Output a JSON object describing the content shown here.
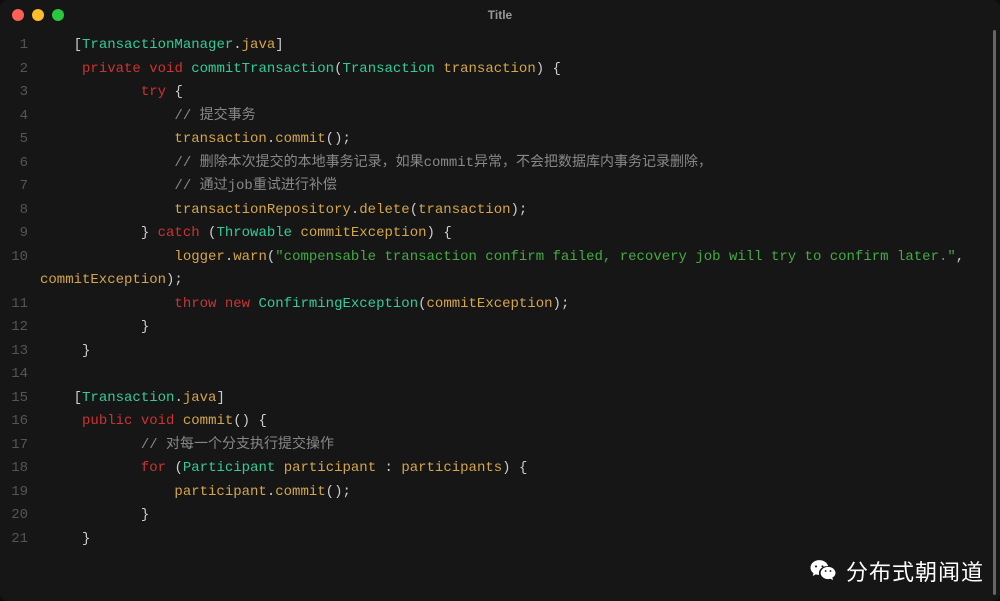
{
  "title": "Title",
  "watermark": "分布式朝闻道",
  "lines": [
    {
      "n": 1,
      "tokens": [
        {
          "t": "    [",
          "c": "c-pun"
        },
        {
          "t": "TransactionManager",
          "c": "c-type"
        },
        {
          "t": ".",
          "c": "c-pun"
        },
        {
          "t": "java",
          "c": "c-var"
        },
        {
          "t": "]",
          "c": "c-pun"
        }
      ]
    },
    {
      "n": 2,
      "tokens": [
        {
          "t": "     ",
          "c": "c-pun"
        },
        {
          "t": "private",
          "c": "c-kw"
        },
        {
          "t": " ",
          "c": "c-pun"
        },
        {
          "t": "void",
          "c": "c-kw"
        },
        {
          "t": " ",
          "c": "c-pun"
        },
        {
          "t": "commitTransaction",
          "c": "c-type"
        },
        {
          "t": "(",
          "c": "c-pun"
        },
        {
          "t": "Transaction",
          "c": "c-type"
        },
        {
          "t": " ",
          "c": "c-pun"
        },
        {
          "t": "transaction",
          "c": "c-var"
        },
        {
          "t": ") {",
          "c": "c-pun"
        }
      ]
    },
    {
      "n": 3,
      "tokens": [
        {
          "t": "            ",
          "c": "c-pun"
        },
        {
          "t": "try",
          "c": "c-kw"
        },
        {
          "t": " {",
          "c": "c-pun"
        }
      ]
    },
    {
      "n": 4,
      "tokens": [
        {
          "t": "                ",
          "c": "c-pun"
        },
        {
          "t": "// 提交事务",
          "c": "c-com"
        }
      ]
    },
    {
      "n": 5,
      "tokens": [
        {
          "t": "                ",
          "c": "c-pun"
        },
        {
          "t": "transaction",
          "c": "c-var"
        },
        {
          "t": ".",
          "c": "c-pun"
        },
        {
          "t": "commit",
          "c": "c-fn"
        },
        {
          "t": "();",
          "c": "c-pun"
        }
      ]
    },
    {
      "n": 6,
      "tokens": [
        {
          "t": "                ",
          "c": "c-pun"
        },
        {
          "t": "// 删除本次提交的本地事务记录，如果commit异常，不会把数据库内事务记录删除，",
          "c": "c-com"
        }
      ]
    },
    {
      "n": 7,
      "tokens": [
        {
          "t": "                ",
          "c": "c-pun"
        },
        {
          "t": "// 通过job重试进行补偿",
          "c": "c-com"
        }
      ]
    },
    {
      "n": 8,
      "tokens": [
        {
          "t": "                ",
          "c": "c-pun"
        },
        {
          "t": "transactionRepository",
          "c": "c-var"
        },
        {
          "t": ".",
          "c": "c-pun"
        },
        {
          "t": "delete",
          "c": "c-fn"
        },
        {
          "t": "(",
          "c": "c-pun"
        },
        {
          "t": "transaction",
          "c": "c-var"
        },
        {
          "t": ");",
          "c": "c-pun"
        }
      ]
    },
    {
      "n": 9,
      "tokens": [
        {
          "t": "            } ",
          "c": "c-pun"
        },
        {
          "t": "catch",
          "c": "c-kw"
        },
        {
          "t": " (",
          "c": "c-pun"
        },
        {
          "t": "Throwable",
          "c": "c-type"
        },
        {
          "t": " ",
          "c": "c-pun"
        },
        {
          "t": "commitException",
          "c": "c-var"
        },
        {
          "t": ") {",
          "c": "c-pun"
        }
      ]
    },
    {
      "n": 10,
      "wrap": true,
      "tokens": [
        {
          "t": "                ",
          "c": "c-pun"
        },
        {
          "t": "logger",
          "c": "c-var"
        },
        {
          "t": ".",
          "c": "c-pun"
        },
        {
          "t": "warn",
          "c": "c-fn"
        },
        {
          "t": "(",
          "c": "c-pun"
        },
        {
          "t": "\"compensable transaction confirm failed, recovery job will try to confirm later.\"",
          "c": "c-str"
        },
        {
          "t": ", ",
          "c": "c-pun"
        },
        {
          "t": "\n",
          "c": ""
        },
        {
          "t": "commitException",
          "c": "c-var"
        },
        {
          "t": ");",
          "c": "c-pun"
        }
      ]
    },
    {
      "n": 11,
      "tokens": [
        {
          "t": "                ",
          "c": "c-pun"
        },
        {
          "t": "throw",
          "c": "c-kw"
        },
        {
          "t": " ",
          "c": "c-pun"
        },
        {
          "t": "new",
          "c": "c-kw"
        },
        {
          "t": " ",
          "c": "c-pun"
        },
        {
          "t": "ConfirmingException",
          "c": "c-type"
        },
        {
          "t": "(",
          "c": "c-pun"
        },
        {
          "t": "commitException",
          "c": "c-var"
        },
        {
          "t": ");",
          "c": "c-pun"
        }
      ]
    },
    {
      "n": 12,
      "tokens": [
        {
          "t": "            }",
          "c": "c-pun"
        }
      ]
    },
    {
      "n": 13,
      "tokens": [
        {
          "t": "     }",
          "c": "c-pun"
        }
      ]
    },
    {
      "n": 14,
      "tokens": [
        {
          "t": " ",
          "c": "c-pun"
        }
      ]
    },
    {
      "n": 15,
      "tokens": [
        {
          "t": "    [",
          "c": "c-pun"
        },
        {
          "t": "Transaction",
          "c": "c-type"
        },
        {
          "t": ".",
          "c": "c-pun"
        },
        {
          "t": "java",
          "c": "c-var"
        },
        {
          "t": "]",
          "c": "c-pun"
        }
      ]
    },
    {
      "n": 16,
      "tokens": [
        {
          "t": "     ",
          "c": "c-pun"
        },
        {
          "t": "public",
          "c": "c-kw"
        },
        {
          "t": " ",
          "c": "c-pun"
        },
        {
          "t": "void",
          "c": "c-kw"
        },
        {
          "t": " ",
          "c": "c-pun"
        },
        {
          "t": "commit",
          "c": "c-fn"
        },
        {
          "t": "() {",
          "c": "c-pun"
        }
      ]
    },
    {
      "n": 17,
      "tokens": [
        {
          "t": "            ",
          "c": "c-pun"
        },
        {
          "t": "// 对每一个分支执行提交操作",
          "c": "c-com"
        }
      ]
    },
    {
      "n": 18,
      "tokens": [
        {
          "t": "            ",
          "c": "c-pun"
        },
        {
          "t": "for",
          "c": "c-kw"
        },
        {
          "t": " (",
          "c": "c-pun"
        },
        {
          "t": "Participant",
          "c": "c-type"
        },
        {
          "t": " ",
          "c": "c-pun"
        },
        {
          "t": "participant",
          "c": "c-var"
        },
        {
          "t": " : ",
          "c": "c-pun"
        },
        {
          "t": "participants",
          "c": "c-var"
        },
        {
          "t": ") {",
          "c": "c-pun"
        }
      ]
    },
    {
      "n": 19,
      "tokens": [
        {
          "t": "                ",
          "c": "c-pun"
        },
        {
          "t": "participant",
          "c": "c-var"
        },
        {
          "t": ".",
          "c": "c-pun"
        },
        {
          "t": "commit",
          "c": "c-fn"
        },
        {
          "t": "();",
          "c": "c-pun"
        }
      ]
    },
    {
      "n": 20,
      "tokens": [
        {
          "t": "            }",
          "c": "c-pun"
        }
      ]
    },
    {
      "n": 21,
      "tokens": [
        {
          "t": "     }",
          "c": "c-pun"
        }
      ]
    }
  ]
}
